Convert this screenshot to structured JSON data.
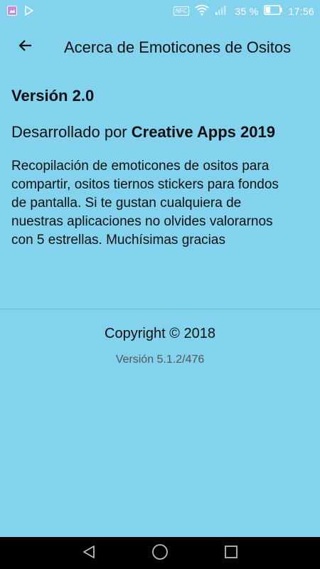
{
  "status_bar": {
    "left_icons": [
      "gallery-icon",
      "play-store-icon"
    ],
    "nfc_label": "NFC",
    "battery_percent": "35 %",
    "battery_level": 0.35,
    "time": "17:56"
  },
  "toolbar": {
    "back_icon": "arrow-left-icon",
    "title": "Acerca de Emoticones de Ositos"
  },
  "content": {
    "version_title": "Versión 2.0",
    "developed_by_prefix": "Desarrollado por ",
    "developer_name": "Creative Apps 2019",
    "description": "Recopilación de emoticones de ositos para compartir, ositos tiernos stickers para fondos de pantalla. Si te gustan cualquiera de nuestras aplicaciones no olvides valorarnos con 5 estrellas. Muchísimas gracias",
    "copyright": "Copyright © 2018",
    "app_version": "Versión 5.1.2/476"
  },
  "nav_bar": {
    "buttons": [
      "back-triangle-icon",
      "home-circle-icon",
      "recents-square-icon"
    ]
  },
  "colors": {
    "background": "#84D3EE",
    "nav_bar": "#000000",
    "status_icons": "#FFFFFF"
  }
}
